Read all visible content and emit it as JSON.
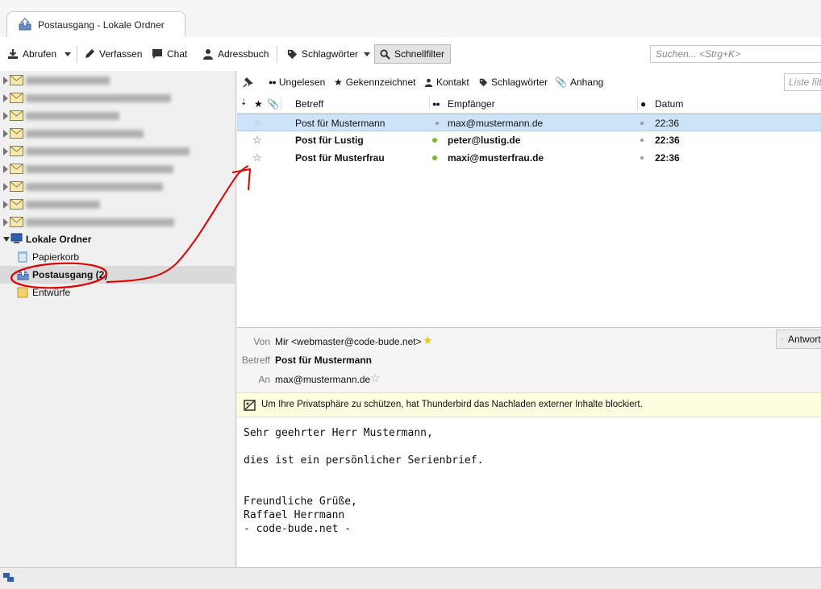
{
  "tab": {
    "title": "Postausgang - Lokale Ordner"
  },
  "toolbar": {
    "get_mail": "Abrufen",
    "write": "Verfassen",
    "chat": "Chat",
    "address_book": "Adressbuch",
    "tags": "Schlagwörter",
    "quick_filter": "Schnellfilter",
    "search_placeholder": "Suchen... <Strg+K>"
  },
  "folders": {
    "local_folders": "Lokale Ordner",
    "trash": "Papierkorb",
    "outbox": "Postausgang (2)",
    "drafts": "Entwürfe"
  },
  "quickfilter": {
    "unread": "Ungelesen",
    "starred": "Gekennzeichnet",
    "contact": "Kontakt",
    "tags": "Schlagwörter",
    "attachment": "Anhang",
    "filter_placeholder": "Liste filtern"
  },
  "thread_columns": {
    "subject": "Betreff",
    "recipient": "Empfänger",
    "date": "Datum"
  },
  "messages": [
    {
      "subject": "Post für Mustermann",
      "recipient": "max@mustermann.de",
      "date": "22:36",
      "selected": true,
      "unread": false
    },
    {
      "subject": "Post für Lustig",
      "recipient": "peter@lustig.de",
      "date": "22:36",
      "selected": false,
      "unread": true
    },
    {
      "subject": "Post für Musterfrau",
      "recipient": "maxi@musterfrau.de",
      "date": "22:36",
      "selected": false,
      "unread": true
    }
  ],
  "header": {
    "from_label": "Von",
    "from_value": "Mir <webmaster@code-bude.net>",
    "subject_label": "Betreff",
    "subject_value": "Post für Mustermann",
    "to_label": "An",
    "to_value": "max@mustermann.de",
    "reply": "Antworten"
  },
  "notice": "Um Ihre Privatsphäre zu schützen, hat Thunderbird das Nachladen externer Inhalte blockiert.",
  "body": "Sehr geehrter Herr Mustermann,\n\ndies ist ein persönlicher Serienbrief.\n\n\nFreundliche Grüße,\nRaffael Herrmann\n- code-bude.net -",
  "colors": {
    "selection": "#cde3f7",
    "unread_dot": "#7ab929",
    "annotation": "#e00000",
    "notice_bg": "#fffde0"
  }
}
